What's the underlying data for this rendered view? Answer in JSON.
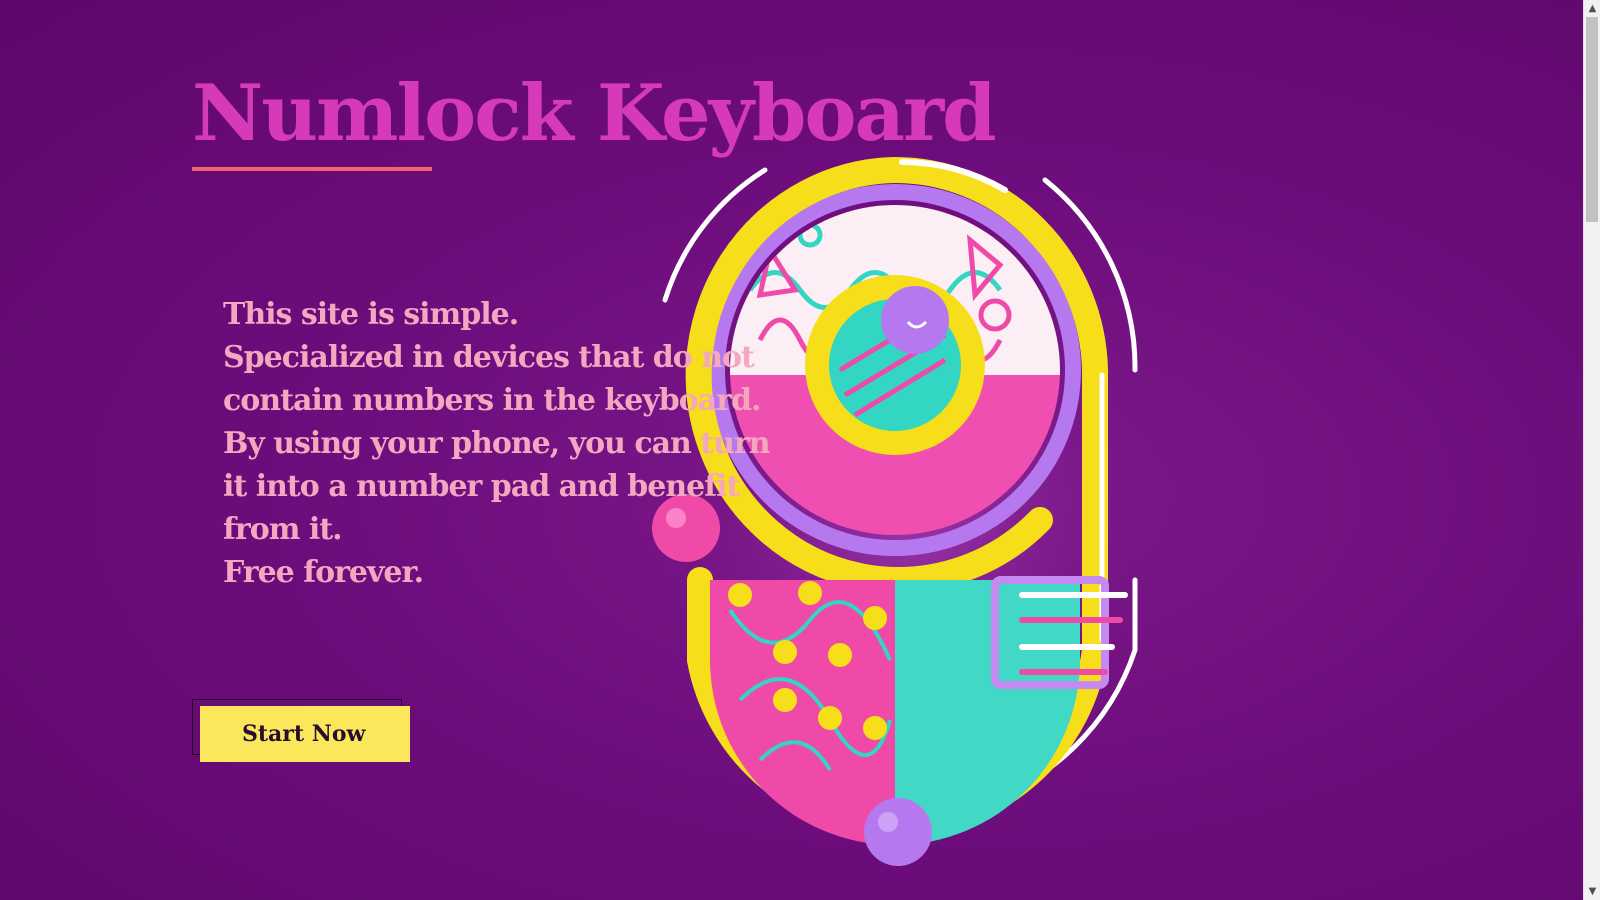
{
  "hero": {
    "title": "Numlock Keyboard",
    "description_lines": [
      "This site is simple.",
      "Specialized in devices that do not",
      "contain numbers in the keyboard.",
      "By using your phone, you can turn",
      "it into a number pad and benefit",
      "from it.",
      "Free forever."
    ],
    "cta_label": "Start Now"
  },
  "illustration": {
    "name": "decorative-number-nine-illustration"
  },
  "colors": {
    "background": "#6a0a78",
    "title": "#d63ab8",
    "underline": "#f2636e",
    "description": "#f3a8bf",
    "button": "#fbe75c",
    "button_text": "#2a0d2c"
  },
  "scrollbar": {
    "up_icon": "chevron-up-icon",
    "down_icon": "chevron-down-icon"
  }
}
